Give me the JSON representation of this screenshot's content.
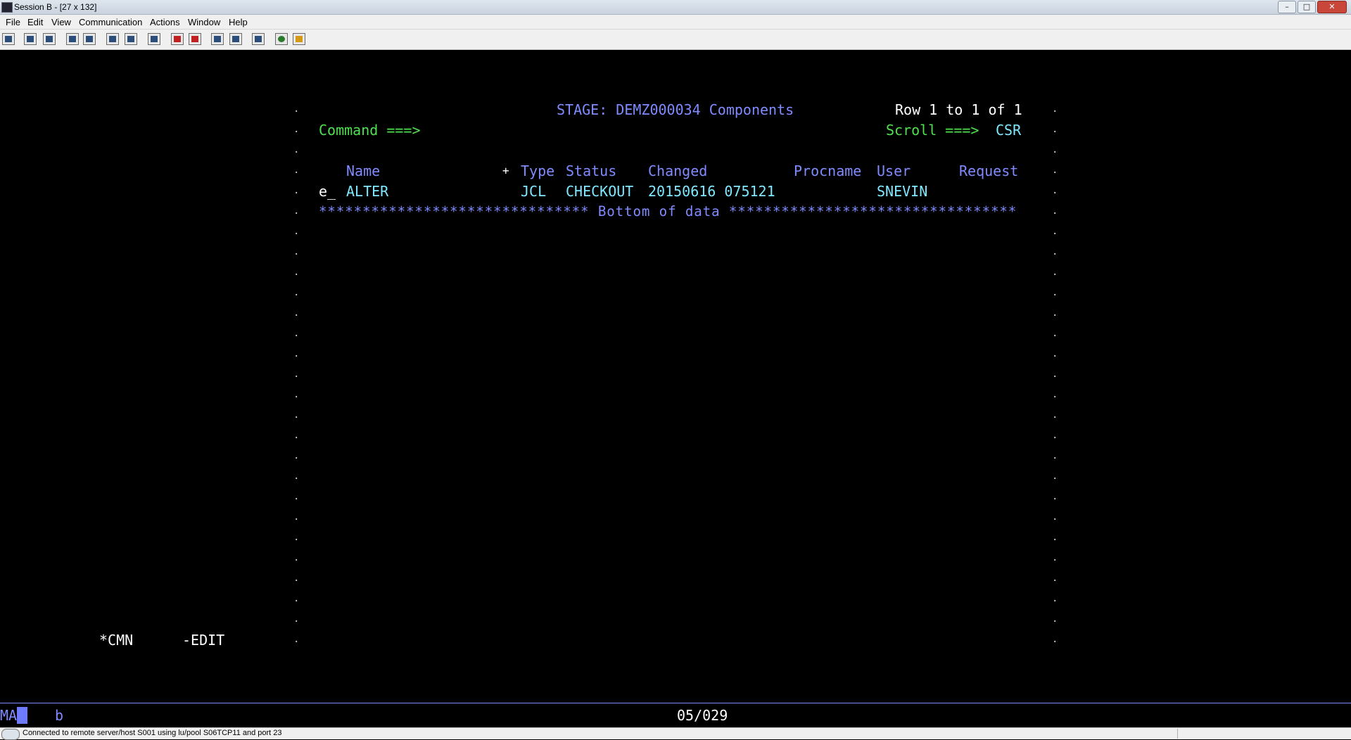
{
  "window": {
    "title": "Session B - [27 x 132]",
    "controls": {
      "minimize": "–",
      "maximize": "□",
      "close": "✕"
    }
  },
  "menu": [
    "File",
    "Edit",
    "View",
    "Communication",
    "Actions",
    "Window",
    "Help"
  ],
  "toolbar_icons": [
    "print-screen-icon",
    "copy-icon",
    "paste-icon",
    "send-file-icon",
    "receive-file-icon",
    "display-icon",
    "keypad-icon",
    "macro-icon",
    "record-macro-icon",
    "stop-macro-icon",
    "play-macro-icon",
    "clear-icon",
    "settings-icon",
    "internet-icon",
    "help-icon"
  ],
  "screen": {
    "panel_title": "STAGE: DEMZ000034 Components",
    "row_info": "Row 1 to 1 of 1",
    "command_label": "Command ===>",
    "command_value": "",
    "scroll_label": "Scroll ===>",
    "scroll_value": "CSR",
    "headers": {
      "name": "Name",
      "plus": "+",
      "type": "Type",
      "status": "Status",
      "changed": "Changed",
      "procname": "Procname",
      "user": "User",
      "request": "Request"
    },
    "rows": [
      {
        "cmd": "e_",
        "name": "ALTER",
        "type": "JCL",
        "status": "CHECKOUT",
        "changed": "20150616 075121",
        "procname": "",
        "user": "SNEVIN",
        "request": ""
      }
    ],
    "bottom_line": "******************************* Bottom of data *********************************",
    "footer_left": "*CMN",
    "footer_right": "-EDIT"
  },
  "oia": {
    "mode": "MA",
    "session": "b",
    "cursor_pos": "05/029"
  },
  "statusbar": {
    "text": "Connected to remote server/host S001 using lu/pool S06TCP11 and port 23"
  },
  "colors": {
    "background": "#000000",
    "blue": "#7f8bff",
    "green": "#4fe04f",
    "white": "#ffffff",
    "cyan": "#7fe8ff"
  }
}
